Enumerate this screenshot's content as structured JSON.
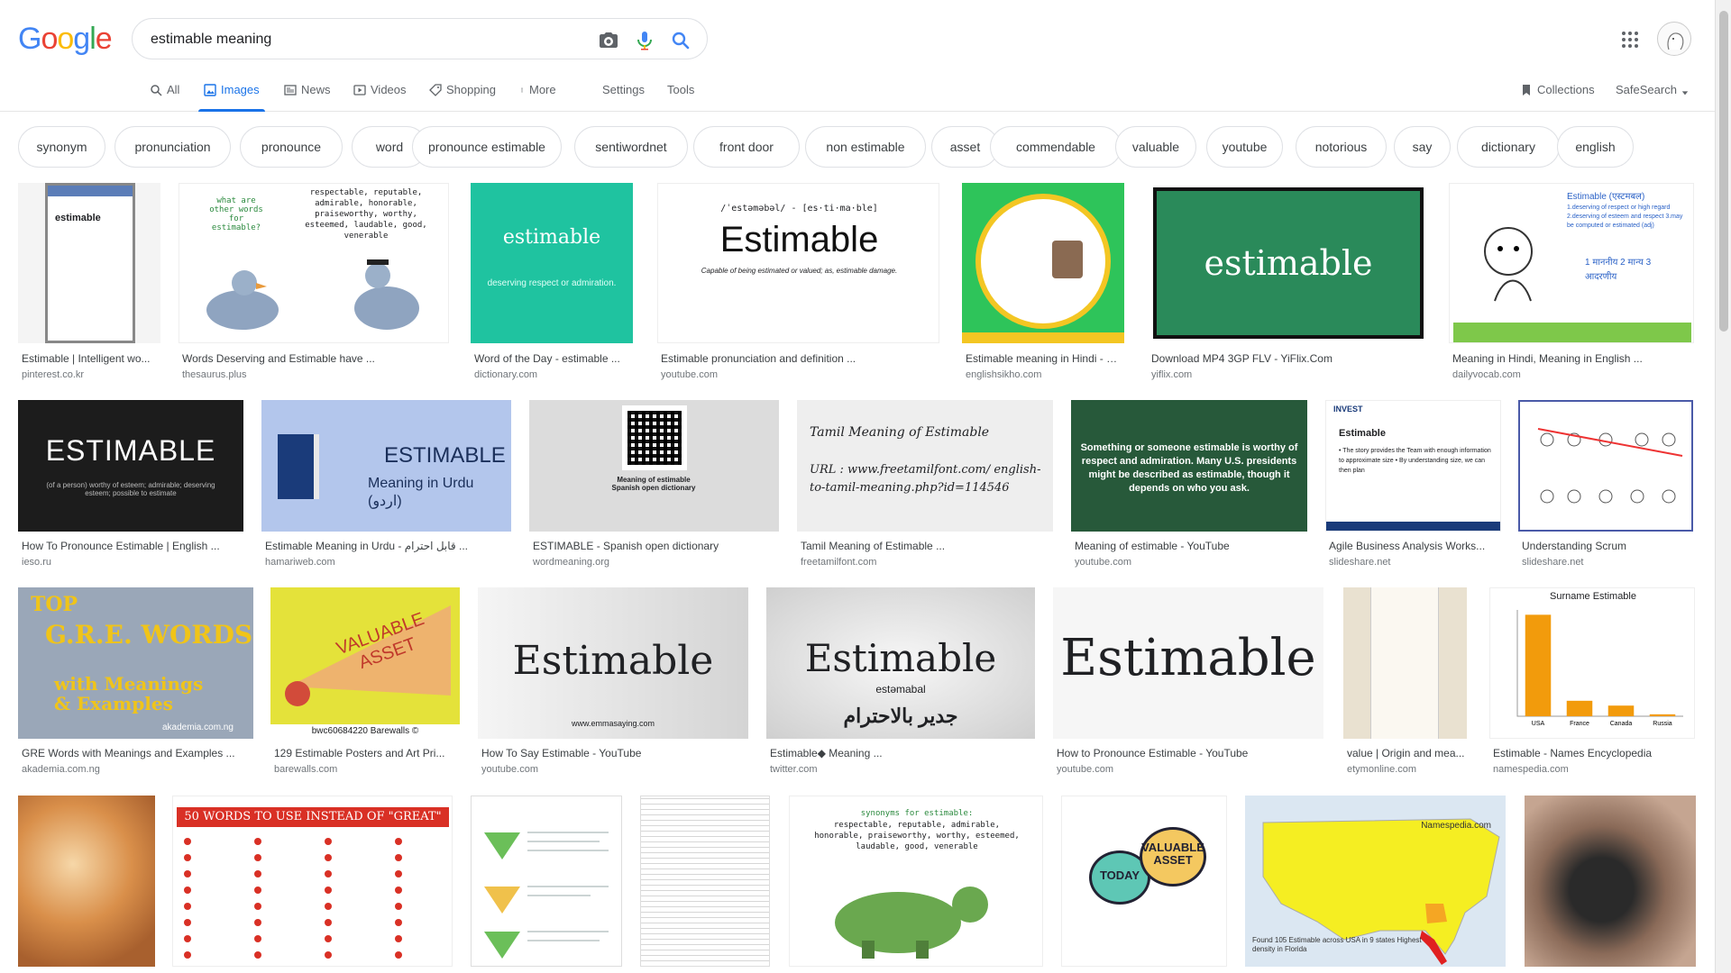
{
  "header": {
    "logo": "Google",
    "search_value": "estimable meaning",
    "tabs": [
      "All",
      "Images",
      "News",
      "Videos",
      "Shopping",
      "More"
    ],
    "settings": "Settings",
    "tools": "Tools",
    "collections": "Collections",
    "safesearch": "SafeSearch"
  },
  "chips": [
    "synonym",
    "pronunciation",
    "pronounce",
    "word",
    "pronounce estimable",
    "sentiwordnet",
    "front door",
    "non estimable",
    "asset",
    "commendable",
    "valuable",
    "youtube",
    "notorious",
    "say",
    "dictionary",
    "english"
  ],
  "results": [
    {
      "title": "Estimable | Intelligent wo...",
      "source": "pinterest.co.kr"
    },
    {
      "title": "Words Deserving and Estimable have ...",
      "source": "thesaurus.plus"
    },
    {
      "title": "Word of the Day - estimable ...",
      "source": "dictionary.com"
    },
    {
      "title": "Estimable pronunciation and definition ...",
      "source": "youtube.com"
    },
    {
      "title": "Estimable meaning in Hindi - E...",
      "source": "englishsikho.com"
    },
    {
      "title": "Download MP4 3GP FLV - YiFlix.Com",
      "source": "yiflix.com"
    },
    {
      "title": "Meaning in Hindi, Meaning in English ...",
      "source": "dailyvocab.com"
    },
    {
      "title": "How To Pronounce Estimable | English ...",
      "source": "ieso.ru"
    },
    {
      "title": "Estimable Meaning in Urdu - قابل احترام ...",
      "source": "hamariweb.com"
    },
    {
      "title": "ESTIMABLE - Spanish open dictionary",
      "source": "wordmeaning.org"
    },
    {
      "title": "Tamil Meaning of Estimable ...",
      "source": "freetamilfont.com"
    },
    {
      "title": "Meaning of estimable - YouTube",
      "source": "youtube.com"
    },
    {
      "title": "Agile Business Analysis Works...",
      "source": "slideshare.net"
    },
    {
      "title": "Understanding Scrum",
      "source": "slideshare.net"
    },
    {
      "title": "GRE Words with Meanings and Examples ...",
      "source": "akademia.com.ng"
    },
    {
      "title": "129 Estimable Posters and Art Pri...",
      "source": "barewalls.com"
    },
    {
      "title": "How To Say Estimable - YouTube",
      "source": "youtube.com"
    },
    {
      "title": "Estimable◆ Meaning ...",
      "source": "twitter.com"
    },
    {
      "title": "How to Pronounce Estimable - YouTube",
      "source": "youtube.com"
    },
    {
      "title": "value | Origin and mea...",
      "source": "etymonline.com"
    },
    {
      "title": "Estimable - Names Encyclopedia",
      "source": "namespedia.com"
    },
    {
      "title": "",
      "source": ""
    },
    {
      "title": "",
      "source": ""
    },
    {
      "title": "",
      "source": ""
    },
    {
      "title": "",
      "source": ""
    },
    {
      "title": "",
      "source": ""
    },
    {
      "title": "",
      "source": ""
    },
    {
      "title": "",
      "source": ""
    },
    {
      "title": "",
      "source": ""
    }
  ],
  "thumb_text": {
    "t1_word": "estimable",
    "t2_q": "what are other words for estimable?",
    "t2_words": "respectable, reputable, admirable, honorable, praiseworthy, worthy, esteemed, laudable, good, venerable",
    "t3_word": "estimable",
    "t3_def": "deserving respect or admiration.",
    "t4_pron": "/ˈestəməbəl/ - [es·ti·ma·ble]",
    "t4_word": "Estimable",
    "t4_def": "Capable of being estimated or valued; as, estimable damage.",
    "t6_word": "estimable",
    "t7_title": "Estimable (एस्टमबल)",
    "t7_lines": "1.deserving of respect or high regard  2.deserving of esteem and respect  3.may be computed or estimated (adj)",
    "t7_hindi": "1 माननीय  2 मान्य  3 आदरणीय",
    "t8_word": "ESTIMABLE",
    "t8_def": "(of a person) worthy of esteem; admirable; deserving esteem; possible to estimate",
    "t9_word": "ESTIMABLE",
    "t9_sub": "Meaning in Urdu (اردو)",
    "t10_text": "Meaning of estimable Spanish open dictionary",
    "t11_title": "Tamil Meaning of Estimable",
    "t11_url": "URL : www.freetamilfont.com/ english-to-tamil-meaning.php?id=114546",
    "t12_text": "Something or someone estimable is worthy of respect and admiration. Many U.S. presidents might be described as estimable, though it depends on who you ask.",
    "t13_head": "INVEST",
    "t13_title": "Estimable",
    "t13_lines": "• The story provides the Team with enough information to approximate size  • By understanding size, we can then plan",
    "t15_top": "TOP",
    "t15_gre": "G.R.E. WORDS",
    "t15_sub": "with Meanings & Examples",
    "t15_site": "akademia.com.ng",
    "t16_text": "VALUABLE ASSET",
    "t16_foot": "bwc60684220 Barewalls ©",
    "t17_word": "Estimable",
    "t17_site": "www.emmasaying.com",
    "t18_word": "Estimable",
    "t18_sub": "estəmabal",
    "t18_ar": "جدير بالاحترام",
    "t19_word": "Estimable",
    "t21_title": "Surname Estimable",
    "t23_title": "50 WORDS TO USE INSTEAD OF \"GREAT\"",
    "t26_head": "synonyms for estimable:",
    "t26_words": "respectable, reputable, admirable, honorable, praiseworthy, worthy, esteemed, laudable, good, venerable",
    "t27_text": "VALUABLE ASSET",
    "t27_today": "TODAY",
    "t28_site": "Namespedia.com",
    "t28_foot": "Found 105 Estimable across USA in 9 states Highest density in Florida"
  },
  "chart_data": {
    "type": "bar",
    "title": "Surname Estimable",
    "categories": [
      "USA",
      "France",
      "Canada",
      "Russia"
    ],
    "values": [
      105,
      16,
      11,
      2
    ],
    "ylim": [
      0,
      110
    ]
  },
  "colors": {
    "accent": "#1a73e8",
    "blue": "#4285f4",
    "red": "#ea4335",
    "yellow": "#fbbc05",
    "green": "#34a853"
  }
}
